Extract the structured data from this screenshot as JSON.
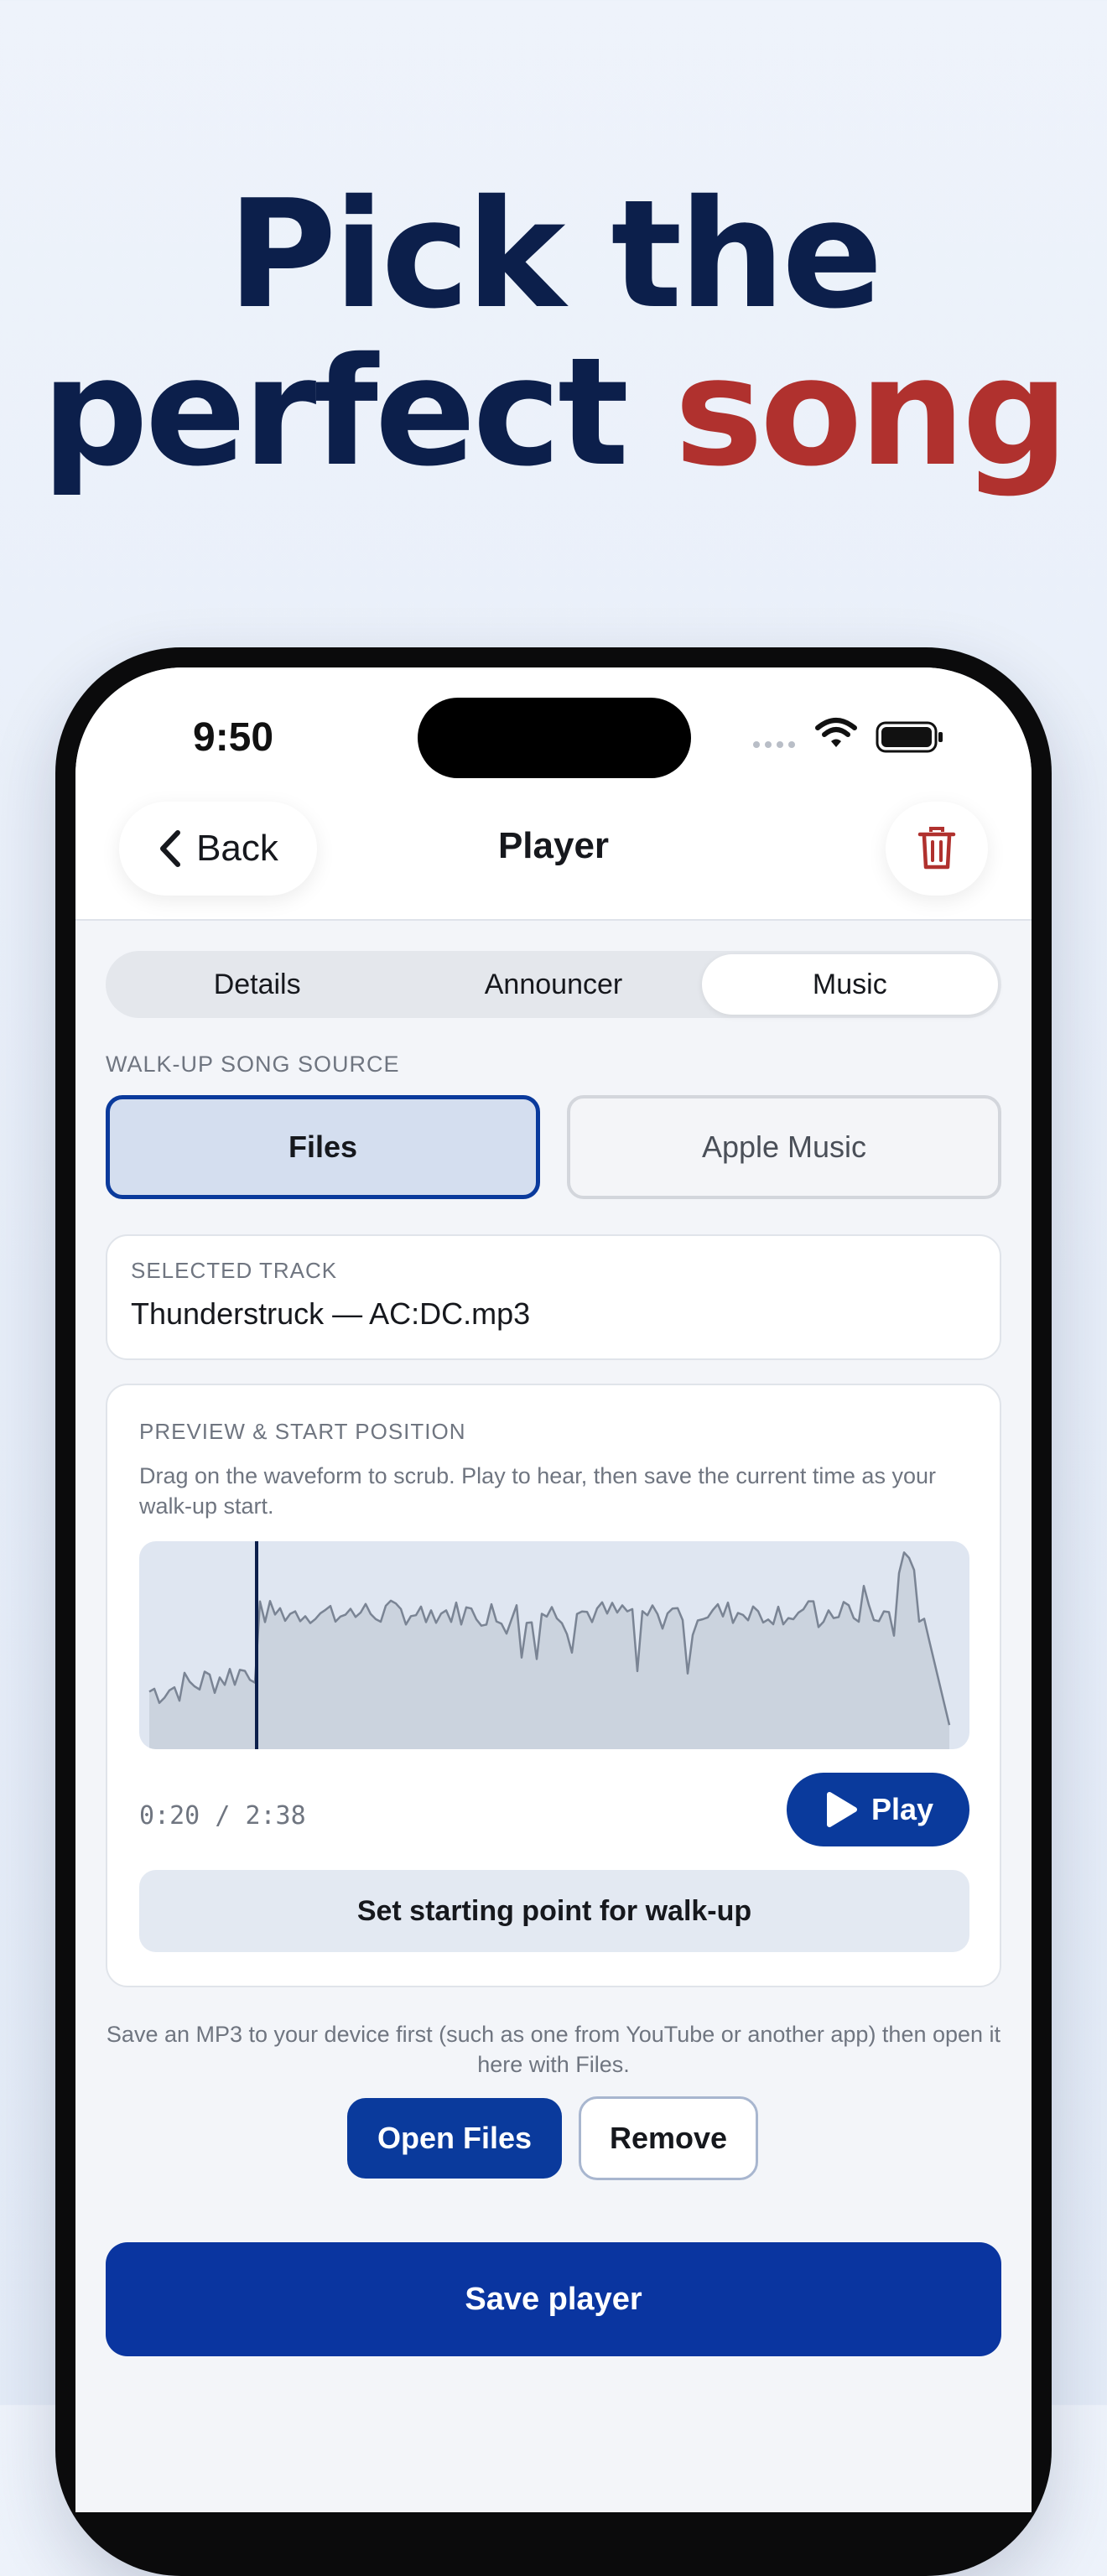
{
  "headline": {
    "line1": "Pick the",
    "line2_main": "perfect ",
    "line2_accent": "song"
  },
  "status_bar": {
    "time": "9:50"
  },
  "nav": {
    "back_label": "Back",
    "title": "Player",
    "delete_icon": "trash-icon"
  },
  "tabs": [
    {
      "label": "Details",
      "active": false
    },
    {
      "label": "Announcer",
      "active": false
    },
    {
      "label": "Music",
      "active": true
    }
  ],
  "source": {
    "section_label": "WALK-UP SONG SOURCE",
    "options": [
      {
        "label": "Files",
        "selected": true
      },
      {
        "label": "Apple Music",
        "selected": false
      }
    ]
  },
  "track": {
    "label": "SELECTED TRACK",
    "name": "Thunderstruck — AC:DC.mp3"
  },
  "preview": {
    "label": "PREVIEW & START POSITION",
    "description": "Drag on the waveform to scrub. Play to hear, then save the current time as your walk-up start.",
    "current_time": "0:20",
    "separator": "/",
    "duration": "2:38",
    "play_label": "Play",
    "set_start_label": "Set starting point for walk-up"
  },
  "hint": "Save an MP3 to your device first (such as one from YouTube or another app) then open it here with Files.",
  "actions": {
    "open_files_label": "Open Files",
    "remove_label": "Remove",
    "save_label": "Save player"
  },
  "colors": {
    "brand_navy": "#0c1f4b",
    "accent_red": "#b0312e",
    "primary_blue": "#0a3a9c"
  }
}
